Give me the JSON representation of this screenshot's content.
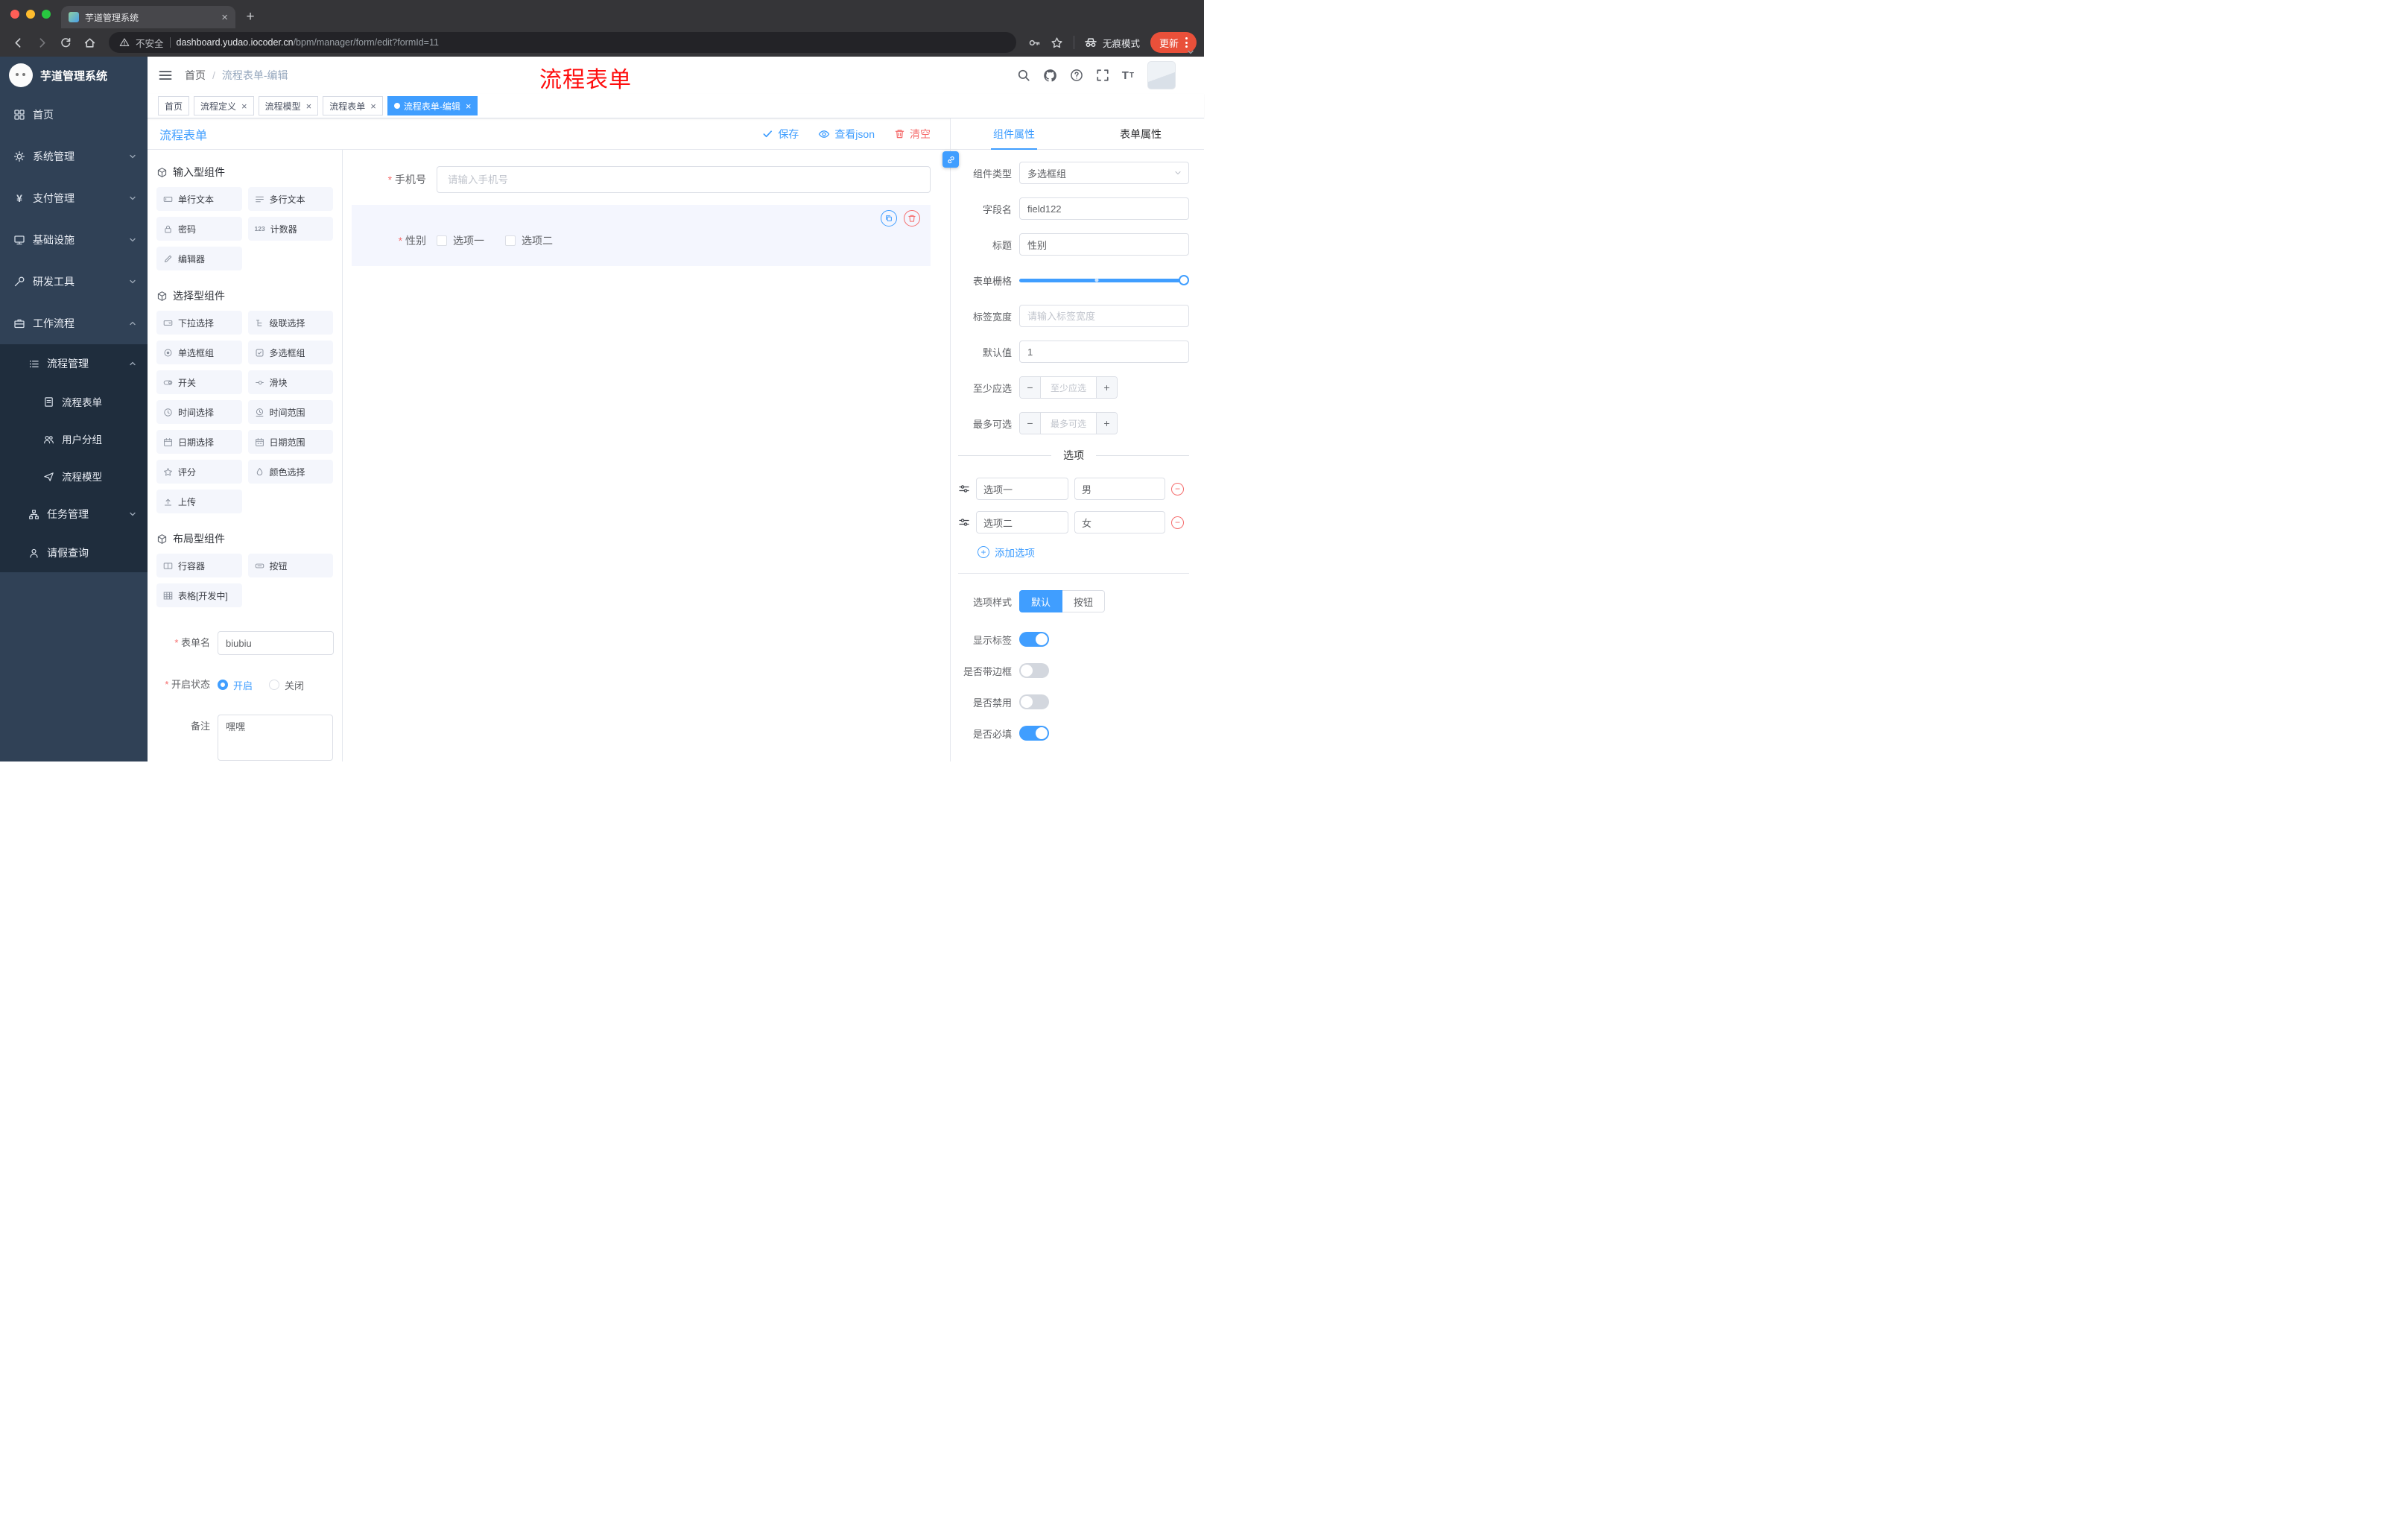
{
  "colors": {
    "accent": "#409eff",
    "danger": "#f56c6c",
    "sidebar_bg": "#304156",
    "submenu_bg": "#1f2d3d",
    "update_button": "#e9503a",
    "selected_widget_bg": "#f4f6fe",
    "annotation_red": "#fe0d0d"
  },
  "browser": {
    "tab_title": "芋道管理系统",
    "security_label": "不安全",
    "url_domain": "dashboard.yudao.iocoder.cn",
    "url_path": "/bpm/manager/form/edit?formId=11",
    "incognito_label": "无痕模式",
    "update_label": "更新",
    "new_tab_label": "+",
    "tab_close_label": "×"
  },
  "sidebar": {
    "logo_title": "芋道管理系统",
    "items": [
      {
        "label": "首页"
      },
      {
        "label": "系统管理"
      },
      {
        "label": "支付管理"
      },
      {
        "label": "基础设施"
      },
      {
        "label": "研发工具"
      },
      {
        "label": "工作流程"
      },
      {
        "label": "流程管理"
      },
      {
        "label": "流程表单"
      },
      {
        "label": "用户分组"
      },
      {
        "label": "流程模型"
      },
      {
        "label": "任务管理"
      },
      {
        "label": "请假查询"
      }
    ]
  },
  "navbar": {
    "breadcrumb_home": "首页",
    "breadcrumb_sep": "/",
    "breadcrumb_current": "流程表单-编辑",
    "overlay_title": "流程表单"
  },
  "tags": [
    {
      "label": "首页",
      "closable": false,
      "active": false
    },
    {
      "label": "流程定义",
      "closable": true,
      "active": false
    },
    {
      "label": "流程模型",
      "closable": true,
      "active": false
    },
    {
      "label": "流程表单",
      "closable": true,
      "active": false
    },
    {
      "label": "流程表单-编辑",
      "closable": true,
      "active": true
    }
  ],
  "designer": {
    "title": "流程表单",
    "save_label": "保存",
    "view_json_label": "查看json",
    "clear_label": "清空",
    "groups": [
      {
        "title": "输入型组件",
        "items": [
          "单行文本",
          "多行文本",
          "密码",
          "计数器",
          "编辑器"
        ]
      },
      {
        "title": "选择型组件",
        "items": [
          "下拉选择",
          "级联选择",
          "单选框组",
          "多选框组",
          "开关",
          "滑块",
          "时间选择",
          "时间范围",
          "日期选择",
          "日期范围",
          "评分",
          "颜色选择",
          "上传"
        ]
      },
      {
        "title": "布局型组件",
        "items": [
          "行容器",
          "按钮",
          "表格[开发中]"
        ]
      }
    ],
    "meta": {
      "form_name_label": "表单名",
      "form_name_value": "biubiu",
      "status_label": "开启状态",
      "status_on": "开启",
      "status_off": "关闭",
      "remark_label": "备注",
      "remark_value": "嘿嘿"
    },
    "canvas": {
      "phone_label": "手机号",
      "phone_placeholder": "请输入手机号",
      "gender_label": "性别",
      "gender_option1": "选项一",
      "gender_option2": "选项二"
    }
  },
  "props": {
    "tab_component": "组件属性",
    "tab_form": "表单属性",
    "component_type_label": "组件类型",
    "component_type_value": "多选框组",
    "field_name_label": "字段名",
    "field_name_value": "field122",
    "title_label": "标题",
    "title_value": "性别",
    "grid_label": "表单栅格",
    "label_width_label": "标签宽度",
    "label_width_placeholder": "请输入标签宽度",
    "default_label": "默认值",
    "default_value": "1",
    "min_label": "至少应选",
    "min_placeholder": "至少应选",
    "max_label": "最多可选",
    "max_placeholder": "最多可选",
    "options_title": "选项",
    "options": [
      {
        "label": "选项一",
        "value": "男"
      },
      {
        "label": "选项二",
        "value": "女"
      }
    ],
    "add_option_label": "添加选项",
    "option_style_label": "选项样式",
    "style_default": "默认",
    "style_button": "按钮",
    "toggles": [
      {
        "label": "显示标签",
        "on": true
      },
      {
        "label": "是否带边框",
        "on": false
      },
      {
        "label": "是否禁用",
        "on": false
      },
      {
        "label": "是否必填",
        "on": true
      }
    ]
  }
}
